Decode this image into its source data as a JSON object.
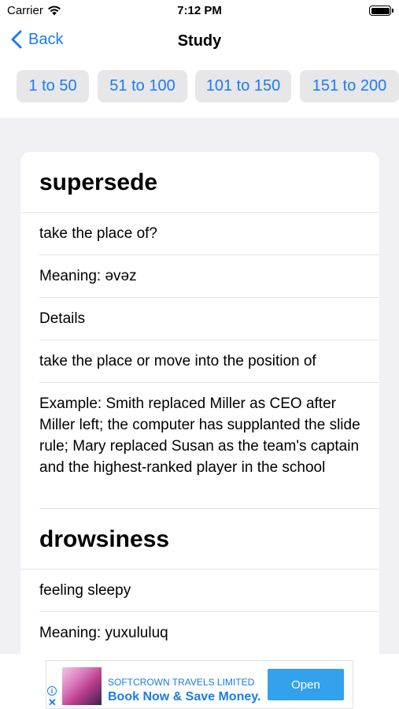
{
  "status_bar": {
    "carrier": "Carrier",
    "time": "7:12 PM"
  },
  "nav": {
    "back_label": "Back",
    "title": "Study"
  },
  "range_tabs": [
    "1 to 50",
    "51 to 100",
    "101 to 150",
    "151 to 200"
  ],
  "words": [
    {
      "word": "supersede",
      "question": "take the place of?",
      "meaning": "Meaning: əvəz",
      "details_label": "Details",
      "definition": "take the place or move into the position of",
      "example": "Example: Smith replaced Miller as CEO after Miller left; the computer has supplanted the slide rule; Mary replaced Susan as the team's captain and the highest-ranked player in the school"
    },
    {
      "word": "drowsiness",
      "question": "feeling sleepy",
      "meaning": "Meaning: yuxululuq"
    }
  ],
  "ad": {
    "company": "SOFTCROWN TRAVELS LIMITED",
    "headline": "Book Now & Save Money.",
    "button_label": "Open",
    "info_symbol": "i",
    "close_symbol": "✕"
  },
  "colors": {
    "accent": "#1a7cf3",
    "background_gray": "#f0f0f5",
    "tab_bg": "#e7e7ea",
    "ad_button": "#33a1ec"
  }
}
